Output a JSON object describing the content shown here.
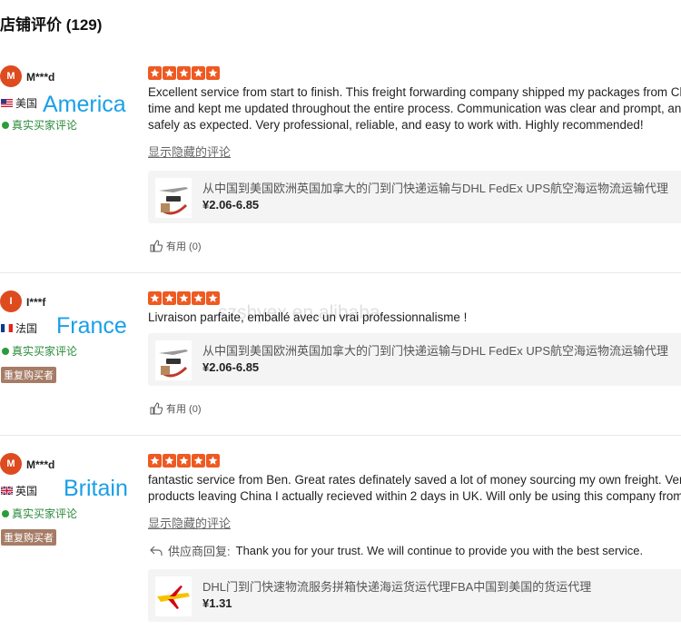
{
  "title": "店铺评价 (129)",
  "watermark": "szshyex.en.alibaba",
  "colors": {
    "avatar": "#dd4b1f",
    "star": "#ee5a22",
    "verified": "#2a8a3a",
    "overlay": "#1aa0e8",
    "repeat_badge": "#a67c66"
  },
  "reviews": [
    {
      "initial": "M",
      "name": "M***d",
      "country": "美国",
      "flag": "us-flag-icon",
      "overlay_label": "America",
      "verified": "真实买家评论",
      "rating": 5,
      "text_lines": [
        "Excellent service from start to finish. This freight forwarding company shipped my packages from China to the US quickly and",
        "time and kept me updated throughout the entire process. Communication was clear and prompt, and my packages arrived",
        "safely as expected. Very professional, reliable, and easy to work with. Highly recommended!"
      ],
      "show_hidden": "显示隐藏的评论",
      "product": {
        "title": "从中国到美国欧洲英国加拿大的门到门快递运输与DHL FedEx UPS航空海运物流运输代理",
        "price": "¥2.06-6.85"
      },
      "helpful": "有用 (0)"
    },
    {
      "initial": "I",
      "name": "I***f",
      "country": "法国",
      "flag": "fr-flag-icon",
      "overlay_label": "France",
      "verified": "真实买家评论",
      "repeat_buyer": "重复购买者",
      "rating": 5,
      "text_lines": [
        "Livraison parfaite, emballé avec un vrai professionnalisme !"
      ],
      "product": {
        "title": "从中国到美国欧洲英国加拿大的门到门快递运输与DHL FedEx UPS航空海运物流运输代理",
        "price": "¥2.06-6.85"
      },
      "helpful": "有用 (0)"
    },
    {
      "initial": "M",
      "name": "M***d",
      "country": "英国",
      "flag": "uk-flag-icon",
      "overlay_label": "Britain",
      "verified": "真实买家评论",
      "repeat_buyer": "重复购买者",
      "rating": 5,
      "text_lines": [
        "fantastic service from Ben. Great rates definately saved a lot of money sourcing my own freight. Very quick service with",
        "products leaving China I actually recieved within 2 days in UK. Will only be using this company from now on."
      ],
      "show_hidden": "显示隐藏的评论",
      "reply_label": "供应商回复:",
      "reply_text": "Thank you for your trust. We will continue to provide you with the best service.",
      "product": {
        "title": "DHL门到门快速物流服务拼箱快递海运货运代理FBA中国到美国的货运代理",
        "price": "¥1.31"
      }
    }
  ]
}
